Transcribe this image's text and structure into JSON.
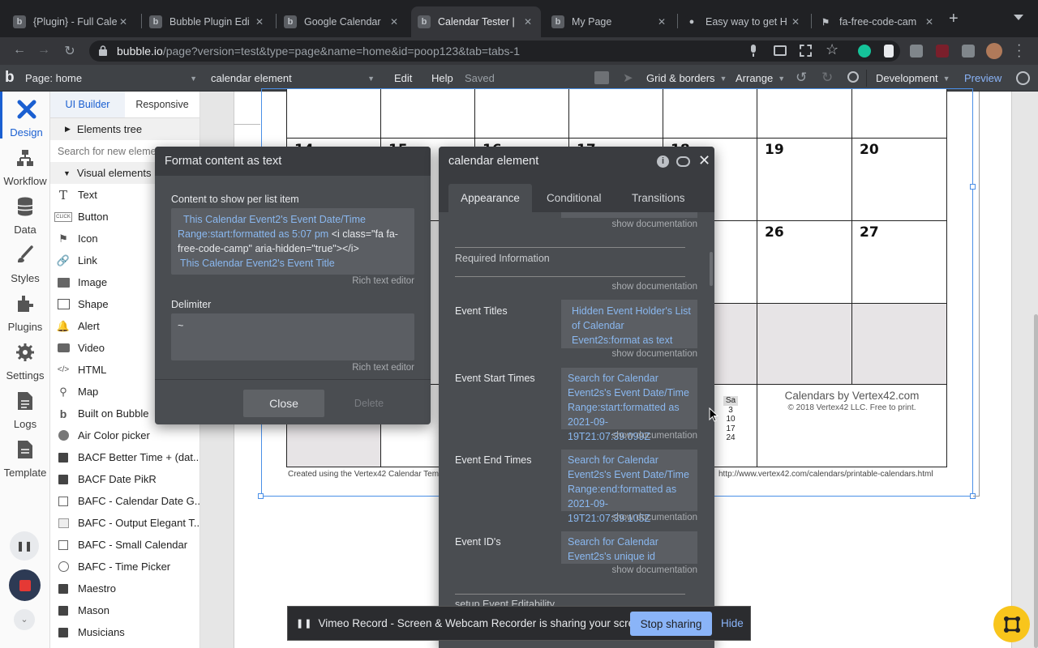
{
  "browser": {
    "tabs": [
      {
        "title": "{Plugin} - Full Cale",
        "icon": "bubble-b",
        "active": false
      },
      {
        "title": "Bubble Plugin Edi",
        "icon": "bubble-b",
        "active": false
      },
      {
        "title": "Google Calendar",
        "icon": "bubble-b",
        "active": false
      },
      {
        "title": "Calendar Tester |",
        "icon": "bubble-b",
        "active": true
      },
      {
        "title": "My Page",
        "icon": "bubble-b",
        "active": false
      },
      {
        "title": "Easy way to get H",
        "icon": "github",
        "active": false
      },
      {
        "title": "fa-free-code-cam",
        "icon": "flag",
        "active": false
      }
    ],
    "url_host": "bubble.io",
    "url_path": "/page?version=test&type=page&name=home&id=poop123&tab=tabs-1"
  },
  "topbar": {
    "page_label": "Page: home",
    "element_select": "calendar element",
    "edit": "Edit",
    "help": "Help",
    "saved": "Saved",
    "grid": "Grid & borders",
    "arrange": "Arrange",
    "dev": "Development",
    "preview": "Preview"
  },
  "leftnav": [
    {
      "label": "Design",
      "icon": "design-icon",
      "active": true
    },
    {
      "label": "Workflow",
      "icon": "workflow-icon",
      "active": false
    },
    {
      "label": "Data",
      "icon": "data-icon",
      "active": false
    },
    {
      "label": "Styles",
      "icon": "styles-icon",
      "active": false
    },
    {
      "label": "Plugins",
      "icon": "plugins-icon",
      "active": false
    },
    {
      "label": "Settings",
      "icon": "settings-icon",
      "active": false
    },
    {
      "label": "Logs",
      "icon": "logs-icon",
      "active": false
    },
    {
      "label": "Template",
      "icon": "template-icon",
      "active": false
    }
  ],
  "palette": {
    "tabs": [
      "UI Builder",
      "Responsive"
    ],
    "elements_tree": "Elements tree",
    "search_placeholder": "Search for new elements",
    "visual_elements": "Visual elements",
    "items": [
      {
        "label": "Text",
        "icon": "T"
      },
      {
        "label": "Button",
        "icon": "CLICK"
      },
      {
        "label": "Icon",
        "icon": "flag"
      },
      {
        "label": "Link",
        "icon": "link"
      },
      {
        "label": "Image",
        "icon": "img"
      },
      {
        "label": "Shape",
        "icon": "sq"
      },
      {
        "label": "Alert",
        "icon": "bell"
      },
      {
        "label": "Video",
        "icon": "vid"
      },
      {
        "label": "HTML",
        "icon": "</>"
      },
      {
        "label": "Map",
        "icon": "pin"
      },
      {
        "label": "Built on Bubble",
        "icon": "b"
      },
      {
        "label": "Air Color picker",
        "icon": "pal"
      },
      {
        "label": "BACF Better Time + (dat...",
        "icon": "blk"
      },
      {
        "label": "BACF Date PikR",
        "icon": "blk"
      },
      {
        "label": "BAFC - Calendar Date G...",
        "icon": "cal"
      },
      {
        "label": "BAFC - Output Elegant T...",
        "icon": "lst"
      },
      {
        "label": "BAFC - Small Calendar",
        "icon": "cal"
      },
      {
        "label": "BAFC - Time Picker",
        "icon": "clk"
      },
      {
        "label": "Maestro",
        "icon": "blk"
      },
      {
        "label": "Mason",
        "icon": "blk"
      },
      {
        "label": "Musicians",
        "icon": "blk"
      }
    ]
  },
  "calendar": {
    "row2_days": [
      "14",
      "15",
      "16",
      "17",
      "18",
      "19",
      "20"
    ],
    "row3_days": [
      "26",
      "27"
    ],
    "credit_title": "Calendars by Vertex42.com",
    "credit_sub": "© 2018 Vertex42 LLC. Free to print.",
    "footer_left": "Created using the Vertex42 Calendar Tem",
    "footer_right": "http://www.vertex42.com/calendars/printable-calendars.html",
    "mini_head": "Sa",
    "mini_days": [
      "3",
      "10",
      "17",
      "24"
    ]
  },
  "format_dialog": {
    "title": "Format content as text",
    "content_label": "Content to show per list item",
    "line1_dyn": "This Calendar Event2's Event Date/Time Range:start:formatted as 5:07 pm",
    "line1_static": "<i class=\"fa fa-free-code-camp\" aria-hidden=\"true\"></i>",
    "line2_dyn": "This Calendar Event2's Event Title",
    "rich_editor": "Rich text editor",
    "delimiter_label": "Delimiter",
    "delimiter_value": "~",
    "close": "Close",
    "delete": "Delete"
  },
  "props_dialog": {
    "title": "calendar element",
    "tabs": [
      "Appearance",
      "Conditional",
      "Transitions"
    ],
    "show_doc": "show documentation",
    "section": "Required Information",
    "props": [
      {
        "label": "Event Titles",
        "value": "Hidden Event Holder's List of Calendar Event2s:format as text"
      },
      {
        "label": "Event Start Times",
        "value": "Search for Calendar Event2s's Event Date/Time Range:start:formatted as 2021-09-19T21:07:39.099Z"
      },
      {
        "label": "Event End Times",
        "value": "Search for Calendar Event2s's Event Date/Time Range:end:formatted as 2021-09-19T21:07:39.105Z"
      },
      {
        "label": "Event ID's",
        "value": "Search for Calendar Event2s's unique id"
      }
    ],
    "next_section": "setup Event Editability"
  },
  "vimeo": {
    "text": "Vimeo Record - Screen & Webcam Recorder is sharing your screen.",
    "stop": "Stop sharing",
    "hide": "Hide"
  },
  "colors": {
    "accent": "#1a5fd1",
    "dynamic_text": "#8ab8f0",
    "dialog_bg": "#4a4d51",
    "stop_btn": "#8ab4f8"
  }
}
